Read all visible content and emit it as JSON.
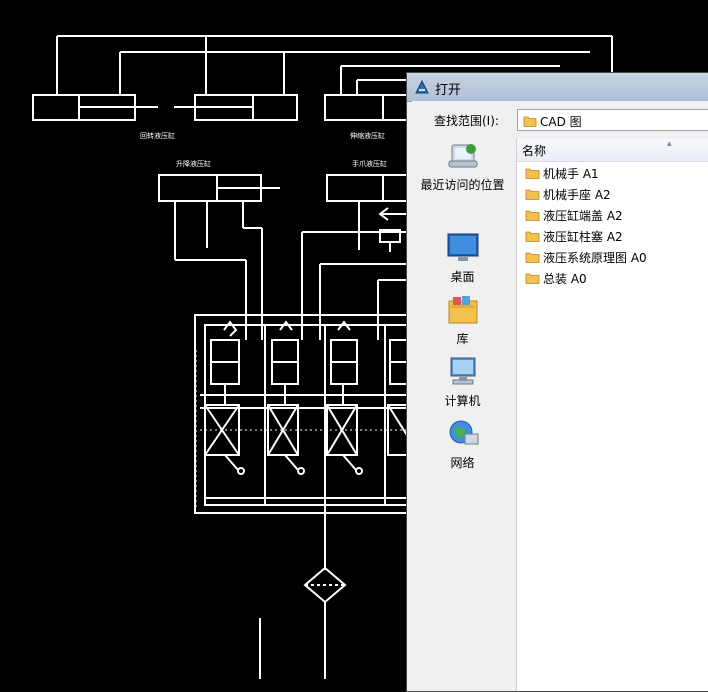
{
  "cad_labels": {
    "label_1": "回转液压缸",
    "label_2": "伸缩液压缸",
    "label_3": "升降液压缸",
    "label_4": "手爪液压缸"
  },
  "dialog": {
    "title": "打开",
    "look_in_label": "查找范围(I):",
    "look_in_value": "CAD 图",
    "places": [
      {
        "label": "最近访问的位置",
        "icon": "recent-places-icon"
      },
      {
        "label": "桌面",
        "icon": "desktop-icon"
      },
      {
        "label": "库",
        "icon": "libraries-icon"
      },
      {
        "label": "计算机",
        "icon": "computer-icon"
      },
      {
        "label": "网络",
        "icon": "network-icon"
      }
    ],
    "column_header": "名称",
    "files": [
      {
        "name": "机械手 A1"
      },
      {
        "name": "机械手座 A2"
      },
      {
        "name": "液压缸端盖 A2"
      },
      {
        "name": "液压缸柱塞 A2"
      },
      {
        "name": "液压系统原理图 A0"
      },
      {
        "name": "总装 A0"
      }
    ]
  },
  "colors": {
    "cad_background": "#000000",
    "cad_lines": "#ffffff",
    "dialog_background": "#f0f0f0",
    "folder_yellow": "#f2c14e"
  }
}
